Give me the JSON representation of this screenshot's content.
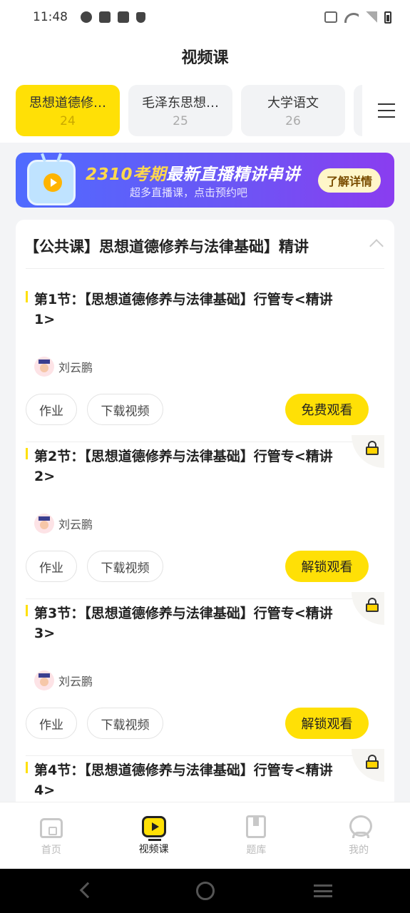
{
  "status_bar": {
    "time": "11:48"
  },
  "header": {
    "title": "视频课"
  },
  "tabs": [
    {
      "name": "思想道德修…",
      "count": "24"
    },
    {
      "name": "毛泽东思想…",
      "count": "25"
    },
    {
      "name": "大学语文",
      "count": "26"
    }
  ],
  "banner": {
    "headline_highlight": "2310考期",
    "headline_rest": "最新直播精讲串讲",
    "subtitle": "超多直播课，点击预约吧",
    "button": "了解详情"
  },
  "course": {
    "title": "【公共课】思想道德修养与法律基础】精讲",
    "lessons": [
      {
        "title": "第1节：【思想道德修养与法律基础】行管专<精讲1>",
        "teacher": "刘云鹏",
        "homework": "作业",
        "download": "下载视频",
        "action": "免费观看",
        "locked": false
      },
      {
        "title": "第2节：【思想道德修养与法律基础】行管专<精讲2>",
        "teacher": "刘云鹏",
        "homework": "作业",
        "download": "下载视频",
        "action": "解锁观看",
        "locked": true
      },
      {
        "title": "第3节：【思想道德修养与法律基础】行管专<精讲3>",
        "teacher": "刘云鹏",
        "homework": "作业",
        "download": "下载视频",
        "action": "解锁观看",
        "locked": true
      },
      {
        "title": "第4节：【思想道德修养与法律基础】行管专<精讲4>",
        "locked": true
      }
    ]
  },
  "bottom_nav": [
    {
      "label": "首页",
      "icon": "home-icon"
    },
    {
      "label": "视频课",
      "icon": "video-icon",
      "active": true
    },
    {
      "label": "题库",
      "icon": "book-icon"
    },
    {
      "label": "我的",
      "icon": "profile-icon"
    }
  ],
  "colors": {
    "accent": "#ffe006",
    "text": "#222222"
  }
}
